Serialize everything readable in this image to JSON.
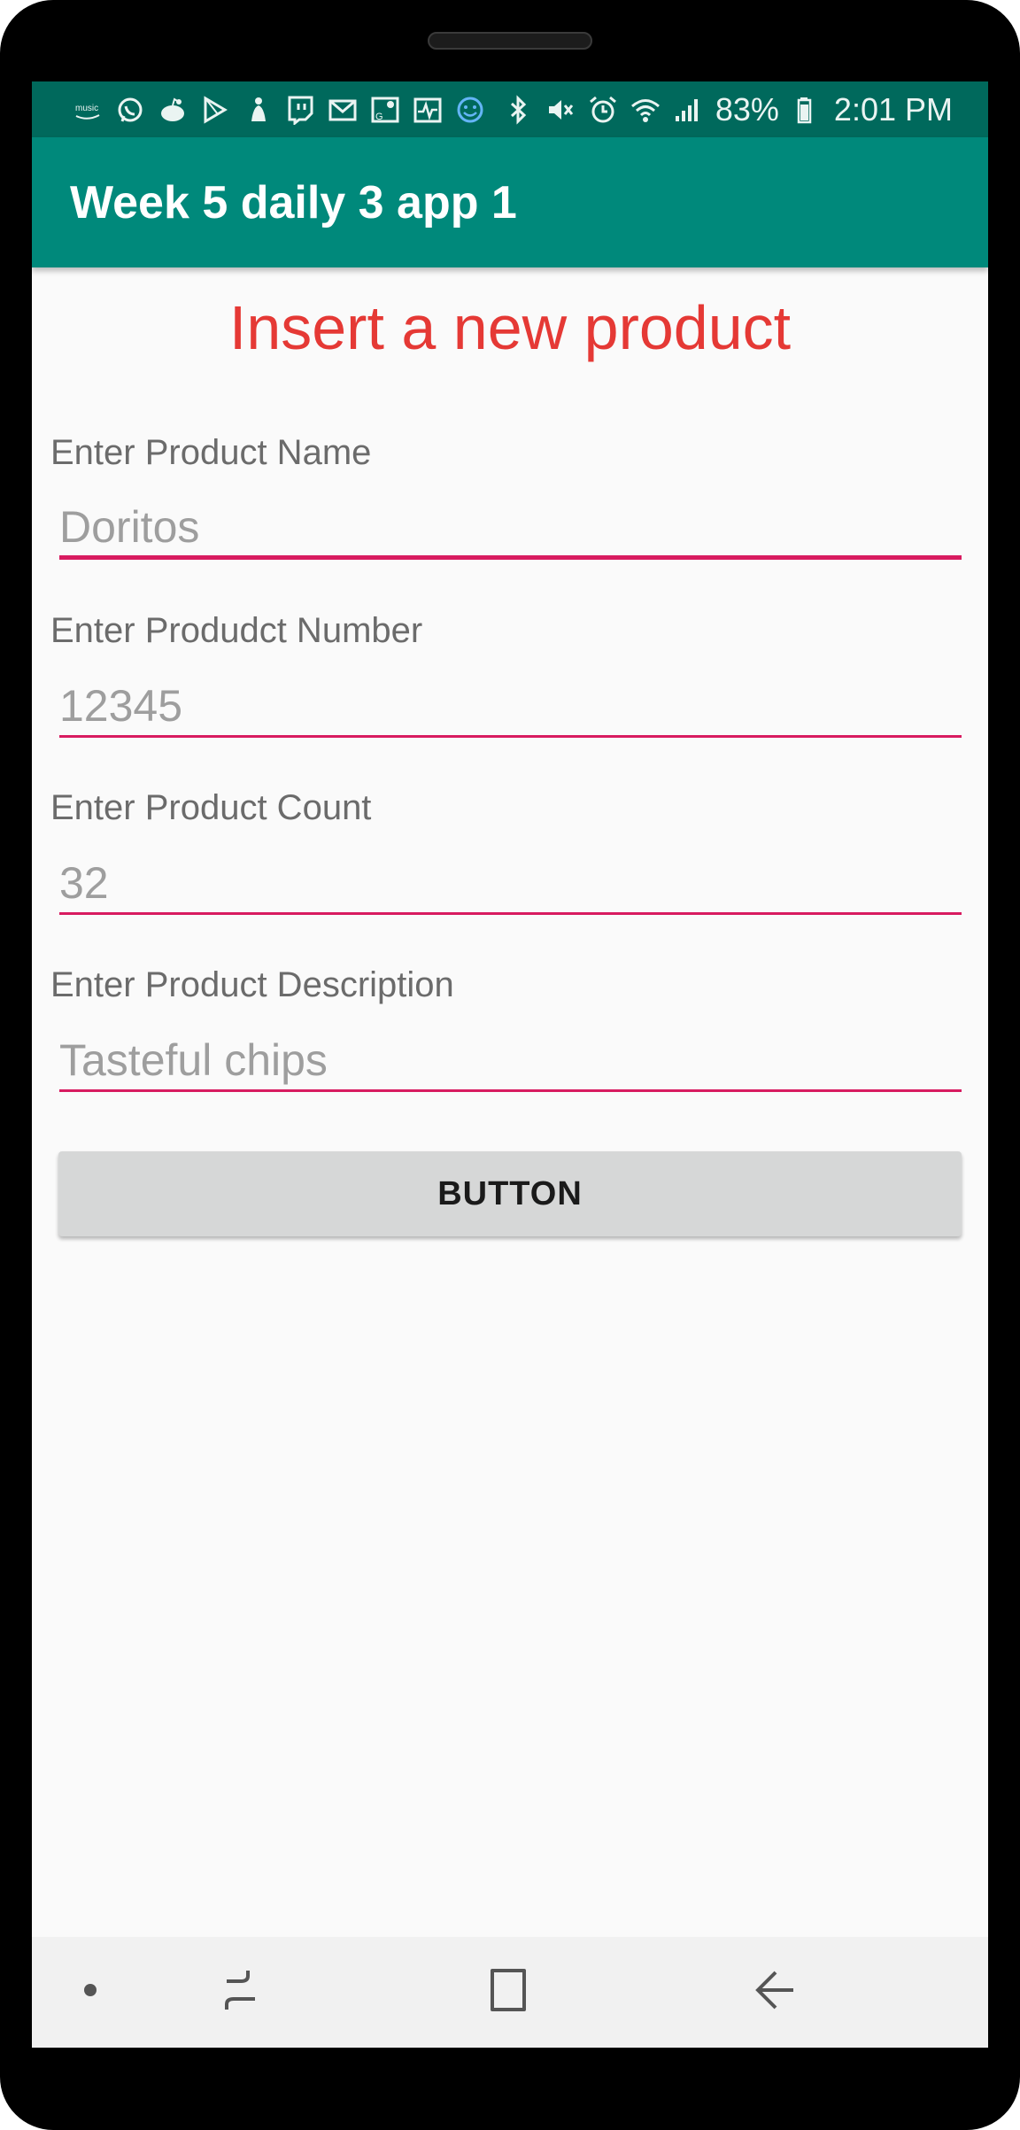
{
  "status_bar": {
    "left_icons": [
      "amazon-music-icon",
      "whatsapp-icon",
      "reddit-icon",
      "play-store-icon",
      "notification-icon",
      "twitch-icon",
      "gmail-icon",
      "maps-icon",
      "health-icon",
      "smiley-icon"
    ],
    "right_icons": [
      "bluetooth-icon",
      "mute-icon",
      "alarm-icon",
      "wifi-icon",
      "signal-icon",
      "battery-icon"
    ],
    "battery": "83%",
    "time": "2:01 PM"
  },
  "app_bar": {
    "title": "Week 5 daily 3 app 1",
    "color": "#00897b"
  },
  "form": {
    "heading": "Insert a new product",
    "heading_color": "#e53935",
    "accent_color": "#d81b60",
    "fields": [
      {
        "label": "Enter Product Name",
        "value": "Doritos",
        "focused": true
      },
      {
        "label": "Enter Produdct Number",
        "value": "12345"
      },
      {
        "label": "Enter Product Count",
        "value": "32"
      },
      {
        "label": "Enter Product Description",
        "value": "Tasteful chips"
      }
    ],
    "button_label": "BUTTON"
  },
  "nav_bar": {
    "items": [
      "dot-icon",
      "recents-icon",
      "home-icon",
      "back-icon"
    ]
  }
}
